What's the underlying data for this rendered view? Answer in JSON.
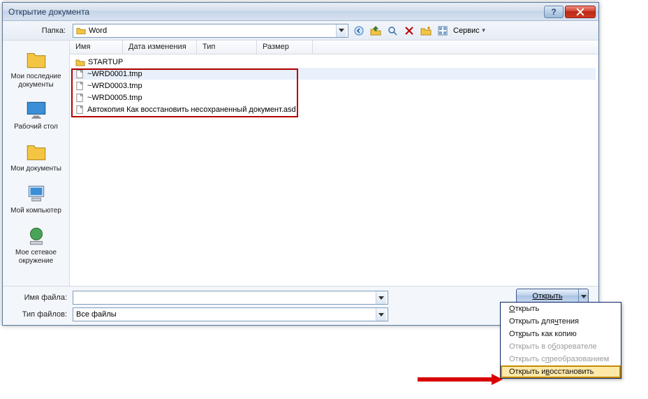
{
  "title": "Открытие документа",
  "toolbar": {
    "folder_label": "Папка:",
    "folder_value": "Word",
    "service_label": "Сервис"
  },
  "sidebar": [
    {
      "label": "Мои последние документы"
    },
    {
      "label": "Рабочий стол"
    },
    {
      "label": "Мои документы"
    },
    {
      "label": "Мой компьютер"
    },
    {
      "label": "Мое сетевое окружение"
    }
  ],
  "columns": {
    "name": "Имя",
    "date": "Дата изменения",
    "type": "Тип",
    "size": "Размер"
  },
  "files": [
    {
      "name": "STARTUP",
      "kind": "folder"
    },
    {
      "name": "~WRD0001.tmp",
      "kind": "file",
      "sel": true
    },
    {
      "name": "~WRD0003.tmp",
      "kind": "file"
    },
    {
      "name": "~WRD0005.tmp",
      "kind": "file"
    },
    {
      "name": "Автокопия Как восстановить несохраненный документ.asd",
      "kind": "file"
    }
  ],
  "bottom": {
    "filename_label": "Имя файла:",
    "filename_value": "",
    "filetype_label": "Тип файлов:",
    "filetype_value": "Все файлы",
    "open_label": "Открыть"
  },
  "menu": [
    {
      "label": "Открыть",
      "u": "О"
    },
    {
      "label": "Открыть для чтения",
      "u": "ч"
    },
    {
      "label": "Открыть как копию",
      "u": "к"
    },
    {
      "label": "Открыть в обозревателе",
      "u": "б",
      "dis": true
    },
    {
      "label": "Открыть с преобразованием",
      "u": "п",
      "dis": true
    },
    {
      "label": "Открыть и восстановить",
      "u": "в",
      "hl": true
    }
  ]
}
